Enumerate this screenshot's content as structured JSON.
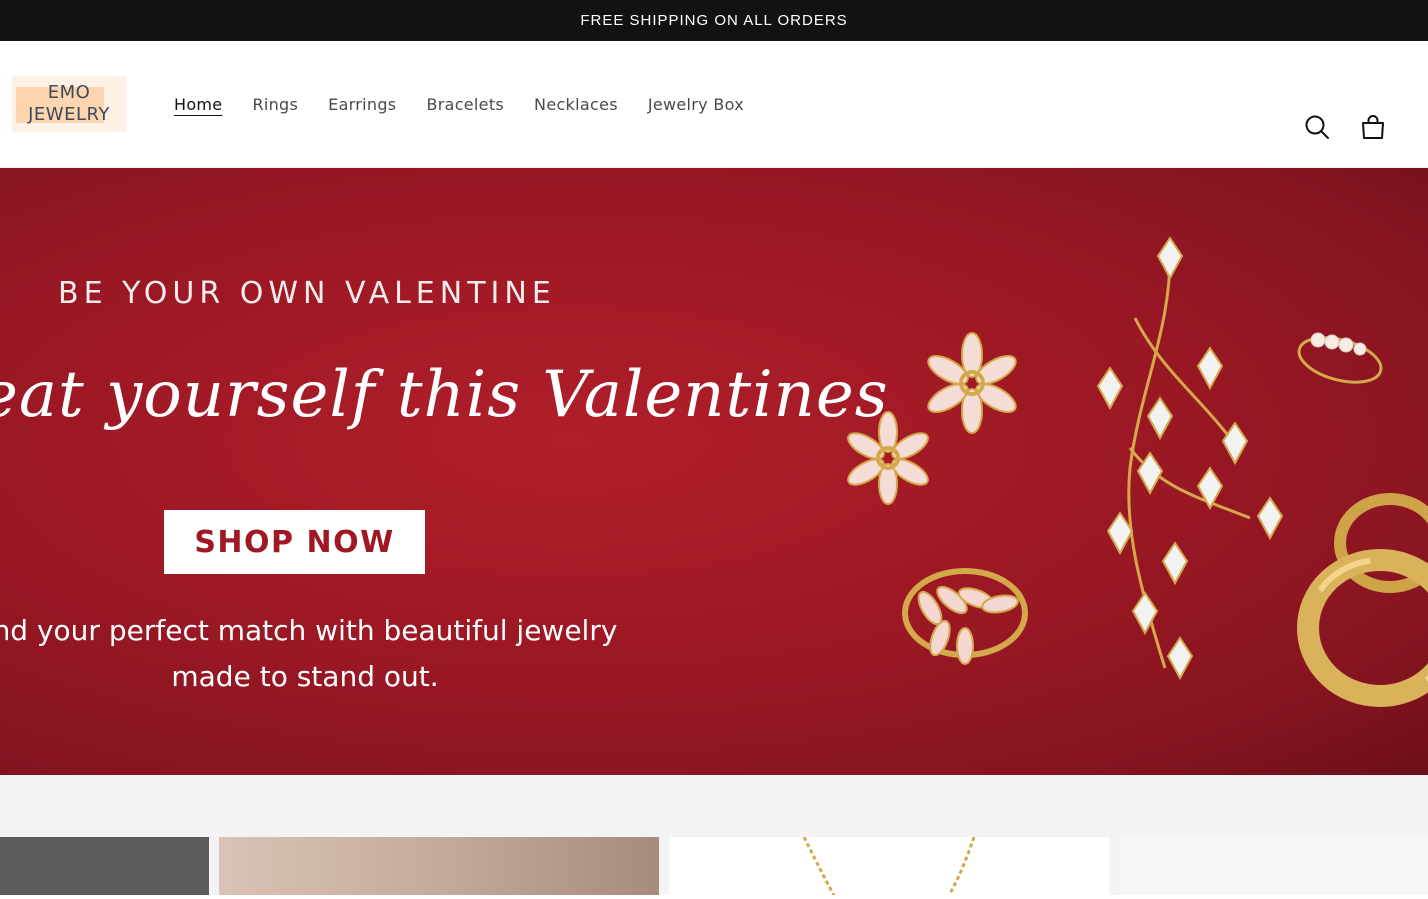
{
  "announcement": {
    "text": "FREE SHIPPING ON ALL ORDERS"
  },
  "logo": {
    "line1": "EMO",
    "line2": "JEWELRY"
  },
  "nav": {
    "items": [
      {
        "label": "Home",
        "active": true
      },
      {
        "label": "Rings"
      },
      {
        "label": "Earrings"
      },
      {
        "label": "Bracelets"
      },
      {
        "label": "Necklaces"
      },
      {
        "label": "Jewelry Box"
      }
    ]
  },
  "icons": {
    "search": "search-icon",
    "cart": "cart-icon"
  },
  "hero": {
    "eyebrow": "BE YOUR OWN VALENTINE",
    "script": "eat yourself this Valentines",
    "button": "SHOP NOW",
    "sub_line1": "nd your perfect match with beautiful jewelry",
    "sub_line2": "made to stand out."
  },
  "colors": {
    "announcement_bg": "#121212",
    "hero_red": "#9c1824",
    "button_text": "#a01824",
    "gold": "#d4a84b"
  }
}
